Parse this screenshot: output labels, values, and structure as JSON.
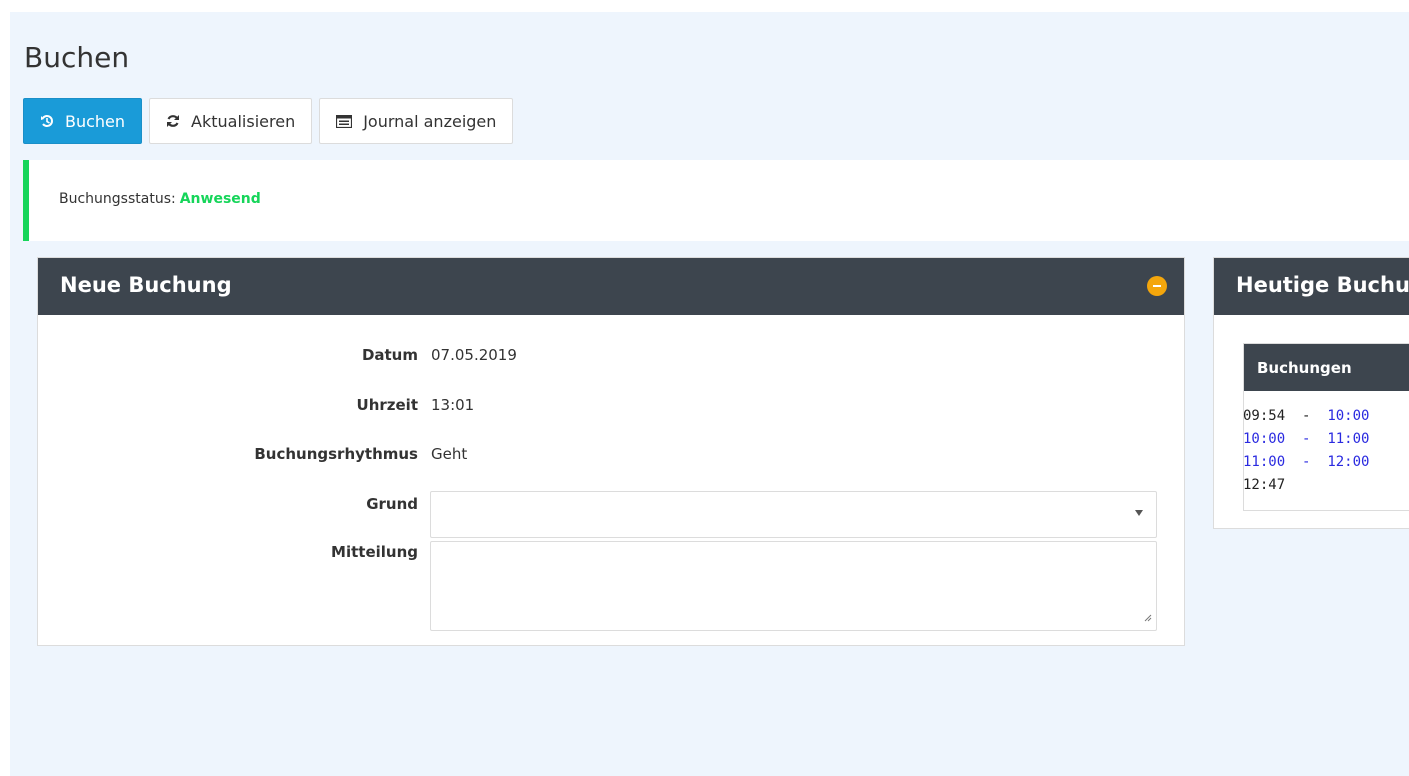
{
  "page": {
    "title": "Buchen"
  },
  "toolbar": {
    "book_label": "Buchen",
    "refresh_label": "Aktualisieren",
    "journal_label": "Journal anzeigen"
  },
  "status": {
    "label": "Buchungsstatus:",
    "value": "Anwesend",
    "color": "#16d55a"
  },
  "new_booking": {
    "title": "Neue Buchung",
    "fields": {
      "date_label": "Datum",
      "date_value": "07.05.2019",
      "time_label": "Uhrzeit",
      "time_value": "13:01",
      "rhythm_label": "Buchungsrhythmus",
      "rhythm_value": "Geht",
      "reason_label": "Grund",
      "reason_value": "",
      "message_label": "Mitteilung",
      "message_value": ""
    }
  },
  "today_bookings": {
    "title": "Heutige Buchu",
    "table_header": "Buchungen",
    "rows": [
      {
        "start": "09:54",
        "sep": "-",
        "end": "10:00"
      },
      {
        "start": "10:00",
        "sep": "-",
        "end": "11:00"
      },
      {
        "start": "11:00",
        "sep": "-",
        "end": "12:00"
      },
      {
        "start": "12:47",
        "sep": "",
        "end": ""
      }
    ]
  },
  "colors": {
    "primary": "#1a9bd8",
    "panel_header": "#3d454e",
    "collapse": "#f4a60c",
    "link_blue": "#2a2ae0"
  }
}
